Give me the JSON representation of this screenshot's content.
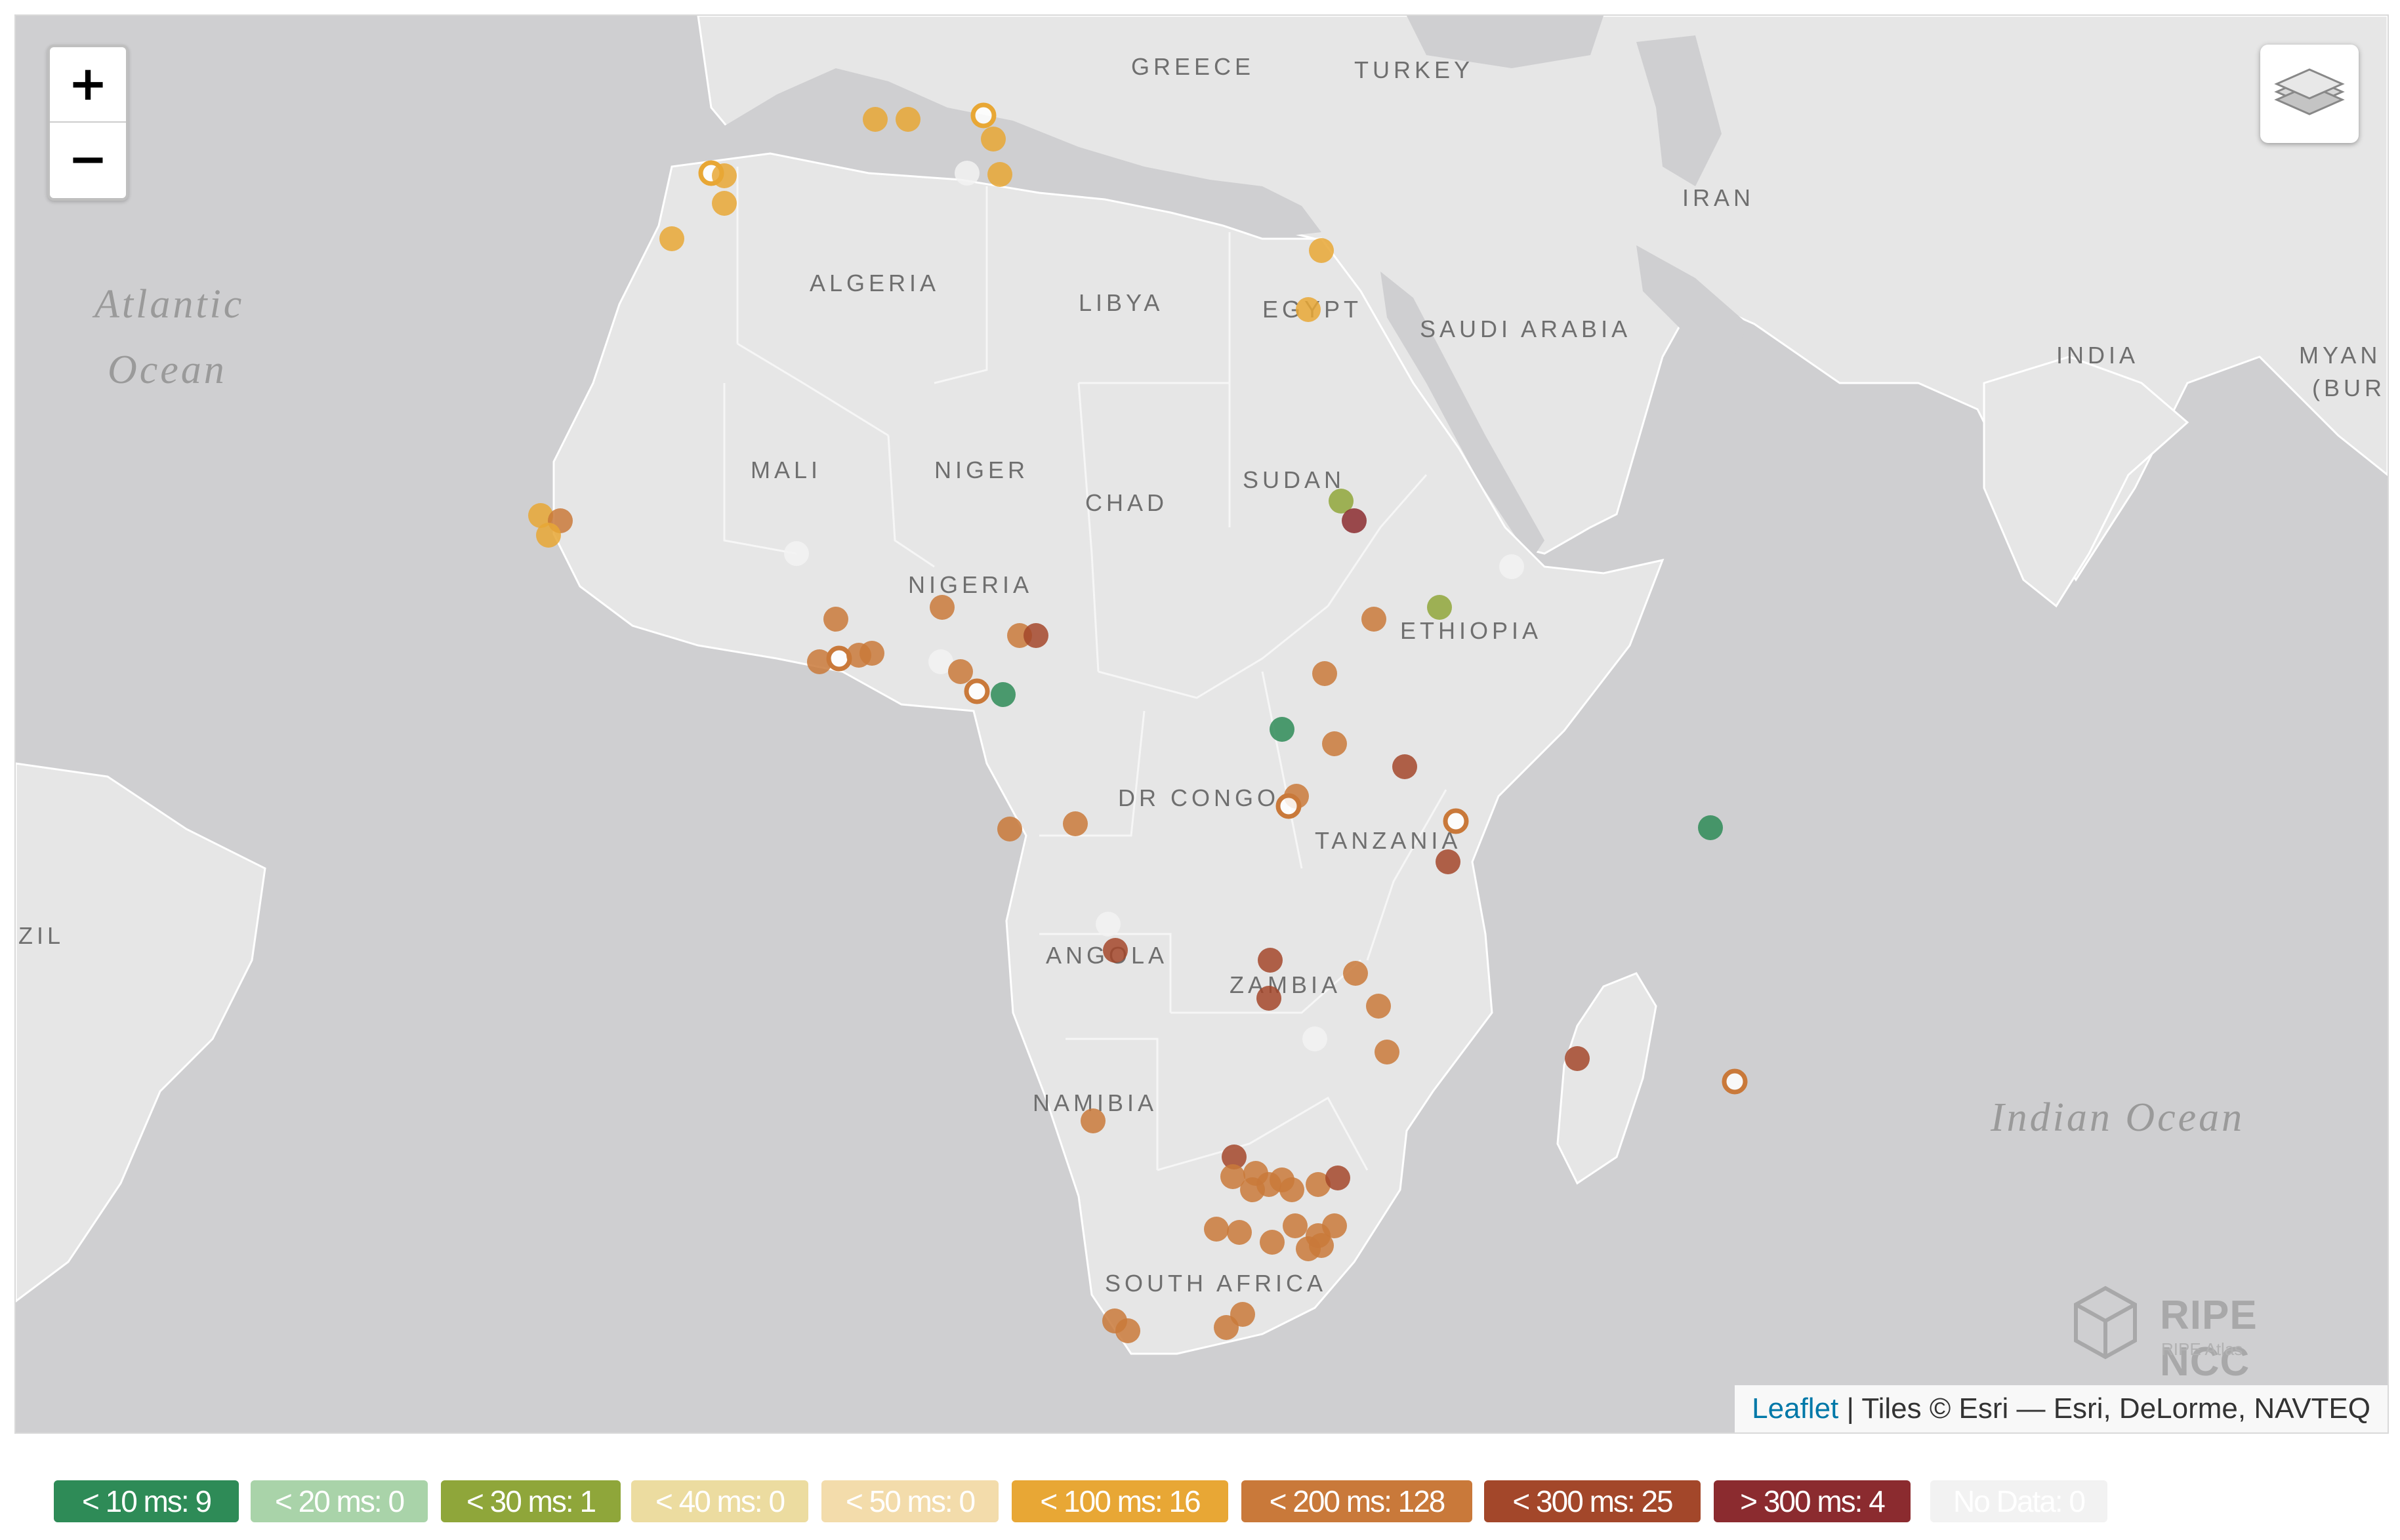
{
  "map": {
    "ocean_labels": {
      "atlantic_line1": "Atlantic",
      "atlantic_line2": "Ocean",
      "indian": "Indian Ocean"
    },
    "country_labels": {
      "greece": "GREECE",
      "turkey": "TURKEY",
      "iran": "IRAN",
      "algeria": "ALGERIA",
      "libya": "LIBYA",
      "egypt": "EGYPT",
      "saudi_arabia": "SAUDI ARABIA",
      "india": "INDIA",
      "myanmar_line1": "MYAN",
      "myanmar_line2": "(BUR",
      "mali": "MALI",
      "niger": "NIGER",
      "chad": "CHAD",
      "sudan": "SUDAN",
      "nigeria": "NIGERIA",
      "ethiopia": "ETHIOPIA",
      "dr_congo": "DR CONGO",
      "tanzania": "TANZANIA",
      "brazil": "ZIL",
      "angola": "ANGOLA",
      "zambia": "ZAMBIA",
      "namibia": "NAMIBIA",
      "south_africa": "SOUTH AFRICA"
    },
    "zoom_in_label": "+",
    "zoom_out_label": "−",
    "layers_icon": "layers-icon",
    "attribution": {
      "link": "Leaflet",
      "text": " | Tiles © Esri — Esri, DeLorme, NAVTEQ"
    },
    "logo": {
      "name": "RIPE NCC",
      "sub": "RIPE Atlas"
    }
  },
  "colors": {
    "lt10": "#2e8b57",
    "lt20": "#a9d3a9",
    "lt30": "#8fa63a",
    "lt40": "#ecdca0",
    "lt50": "#f3dcab",
    "lt100": "#e8a735",
    "lt200": "#c9793a",
    "lt300": "#a3472a",
    "gt300": "#8b2b2f",
    "nodata": "#f2f2f2"
  },
  "legend": [
    {
      "key": "lt10",
      "label": "< 10 ms: 9"
    },
    {
      "key": "lt20",
      "label": "< 20 ms: 0"
    },
    {
      "key": "lt30",
      "label": "< 30 ms: 1"
    },
    {
      "key": "lt40",
      "label": "< 40 ms: 0"
    },
    {
      "key": "lt50",
      "label": "< 50 ms: 0"
    },
    {
      "key": "lt100",
      "label": "< 100 ms: 16"
    },
    {
      "key": "lt200",
      "label": "< 200 ms: 128"
    },
    {
      "key": "lt300",
      "label": "< 300 ms: 25"
    },
    {
      "key": "gt300",
      "label": "> 300 ms: 4"
    },
    {
      "key": "nodata",
      "label": "No Data: 0"
    }
  ]
}
